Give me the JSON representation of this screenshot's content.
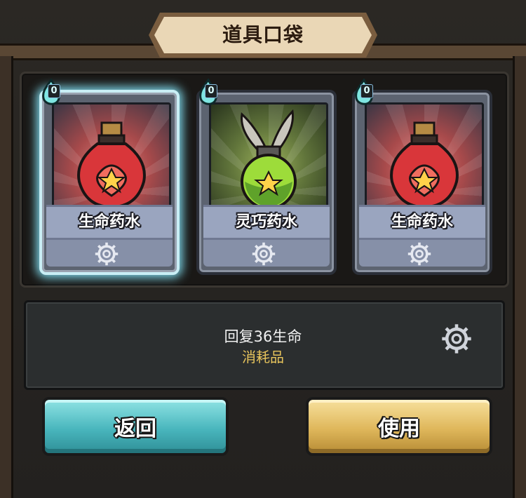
{
  "window": {
    "title": "道具口袋"
  },
  "cards": [
    {
      "name": "生命药水",
      "cost": "0",
      "art": "red-potion",
      "selected": true
    },
    {
      "name": "灵巧药水",
      "cost": "0",
      "art": "green-winged-potion",
      "selected": false
    },
    {
      "name": "生命药水",
      "cost": "0",
      "art": "red-potion",
      "selected": false
    }
  ],
  "detail": {
    "effect": "回复36生命",
    "category": "消耗品"
  },
  "buttons": {
    "back_label": "返回",
    "use_label": "使用"
  },
  "colors": {
    "selected_glow": "#7ed8ea",
    "category_text": "#e7c45c",
    "back_button": "#49b6bd",
    "use_button": "#dfb75b"
  }
}
